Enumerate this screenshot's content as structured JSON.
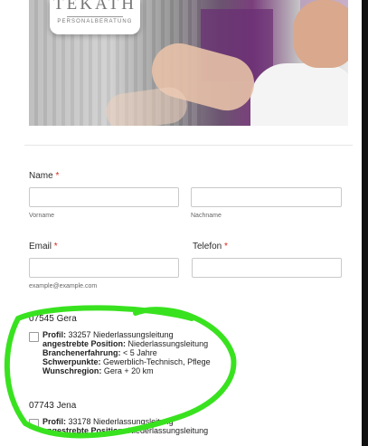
{
  "brand": {
    "name": "TEKATH",
    "tagline": "PERSONALBERATUNG"
  },
  "form": {
    "name_label": "Name",
    "required_mark": "*",
    "first_name_sublabel": "Vorname",
    "last_name_sublabel": "Nachname",
    "email_label": "Email",
    "email_sublabel": "example@example.com",
    "phone_label": "Telefon"
  },
  "jobs": [
    {
      "region": "07545 Gera",
      "profil_label": "Profil:",
      "profil": "33257 Niederlassungsleitung",
      "position_label": "angestrebte Position:",
      "position": "Niederlassungsleitung",
      "experience_label": "Branchenerfahrung:",
      "experience": "< 5 Jahre",
      "focus_label": "Schwerpunkte:",
      "focus": "Gewerblich-Technisch, Pflege",
      "wish_label": "Wunschregion:",
      "wish": "Gera + 20 km"
    },
    {
      "region": "07743 Jena",
      "profil_label": "Profil:",
      "profil": "33178 Niederlassungsleitung",
      "position_label": "angestrebte Position:",
      "position": "Niederlassungsleitung"
    }
  ],
  "colors": {
    "required": "#d9261c",
    "highlight": "#39e21f"
  }
}
